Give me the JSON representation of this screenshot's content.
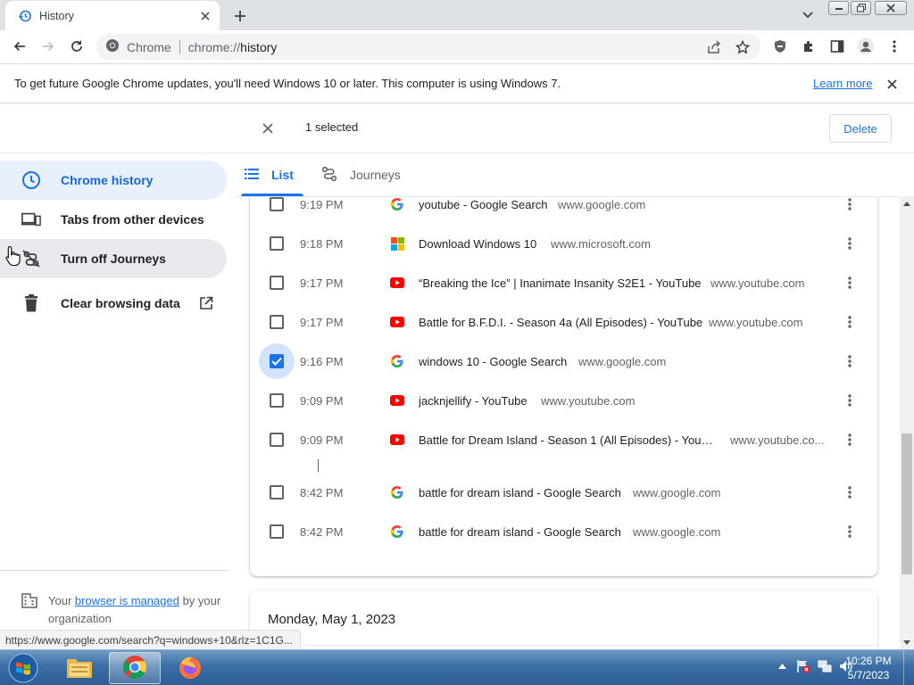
{
  "browser": {
    "tab": {
      "title": "History"
    },
    "omnibox": {
      "site_label": "Chrome",
      "url_scheme": "chrome://",
      "url_path": "history"
    }
  },
  "infobar": {
    "message": "To get future Google Chrome updates, you'll need Windows 10 or later. This computer is using Windows 7.",
    "link": "Learn more"
  },
  "selection": {
    "count_label": "1 selected",
    "delete_label": "Delete"
  },
  "sidebar": {
    "items": [
      {
        "label": "Chrome history",
        "icon": "clock-icon"
      },
      {
        "label": "Tabs from other devices",
        "icon": "devices-icon"
      },
      {
        "label": "Turn off Journeys",
        "icon": "journeys-off-icon"
      },
      {
        "label": "Clear browsing data",
        "icon": "trash-icon"
      }
    ],
    "managed": {
      "prefix": "Your ",
      "link": "browser is managed",
      "suffix": " by your organization"
    }
  },
  "tabs": [
    {
      "label": "List",
      "icon": "list-icon"
    },
    {
      "label": "Journeys",
      "icon": "journeys-icon"
    }
  ],
  "history": {
    "rows": [
      {
        "time": "9:19 PM",
        "title": "youtube - Google Search",
        "domain": "www.google.com",
        "favicon": "google",
        "checked": false
      },
      {
        "time": "9:18 PM",
        "title": "Download Windows 10",
        "domain": "www.microsoft.com",
        "favicon": "microsoft",
        "checked": false
      },
      {
        "time": "9:17 PM",
        "title": "“Breaking the Ice” | Inanimate Insanity S2E1 - YouTube",
        "domain": "www.youtube.com",
        "favicon": "youtube",
        "checked": false
      },
      {
        "time": "9:17 PM",
        "title": "Battle for B.F.D.I. - Season 4a (All Episodes) - YouTube",
        "domain": "www.youtube.com",
        "favicon": "youtube",
        "checked": false
      },
      {
        "time": "9:16 PM",
        "title": "windows 10 - Google Search",
        "domain": "www.google.com",
        "favicon": "google",
        "checked": true
      },
      {
        "time": "9:09 PM",
        "title": "jacknjellify - YouTube",
        "domain": "www.youtube.com",
        "favicon": "youtube",
        "checked": false
      },
      {
        "time": "9:09 PM",
        "title": "Battle for Dream Island - Season 1 (All Episodes) - YouT...",
        "domain": "www.youtube.co...",
        "favicon": "youtube",
        "checked": false
      },
      {
        "time": "8:42 PM",
        "title": "battle for dream island - Google Search",
        "domain": "www.google.com",
        "favicon": "google",
        "checked": false
      },
      {
        "time": "8:42 PM",
        "title": "battle for dream island - Google Search",
        "domain": "www.google.com",
        "favicon": "google",
        "checked": false
      }
    ],
    "next_date": "Monday, May 1, 2023"
  },
  "status_url": "https://www.google.com/search?q=windows+10&rlz=1C1G...",
  "taskbar": {
    "time": "10:26 PM",
    "date": "5/7/2023"
  },
  "colors": {
    "accent": "#1a73e8",
    "active_bg": "#e8f0fe",
    "youtube": "#ff0000"
  }
}
